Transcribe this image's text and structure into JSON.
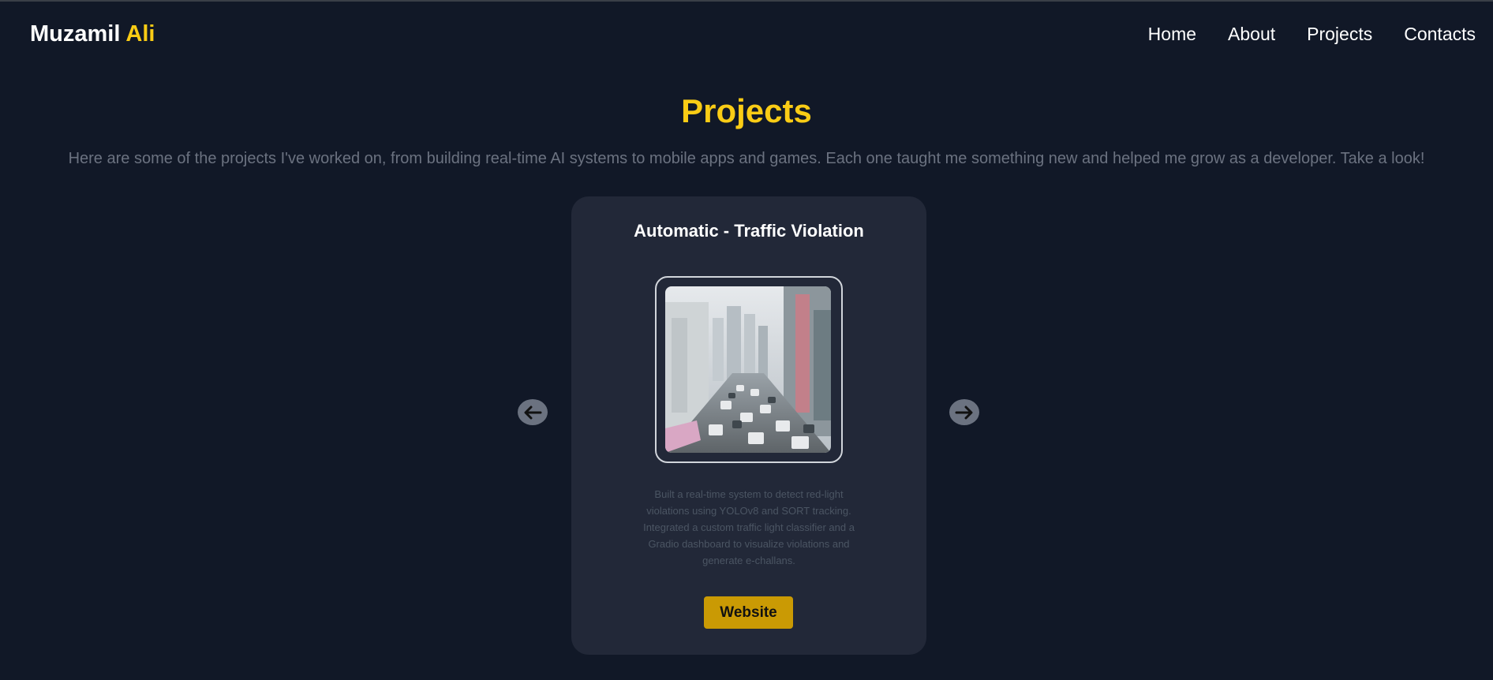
{
  "header": {
    "brand_first": "Muzamil",
    "brand_accent": "Ali",
    "nav": [
      "Home",
      "About",
      "Projects",
      "Contacts"
    ]
  },
  "section": {
    "title": "Projects",
    "subtitle": "Here are some of the projects I've worked on, from building real-time AI systems to mobile apps and games. Each one taught me something new and helped me grow as a developer. Take a look!"
  },
  "carousel": {
    "prev_icon": "arrow-left-icon",
    "next_icon": "arrow-right-icon",
    "card": {
      "title": "Automatic - Traffic Violation",
      "description": "Built a real-time system to detect red-light violations using YOLOv8 and SORT tracking. Integrated a custom traffic light classifier and a Gradio dashboard to visualize violations and generate e-challans.",
      "button_label": "Website"
    }
  },
  "colors": {
    "background": "#111827",
    "accent": "#facc15",
    "card": "#222838",
    "button": "#ca9a04"
  }
}
